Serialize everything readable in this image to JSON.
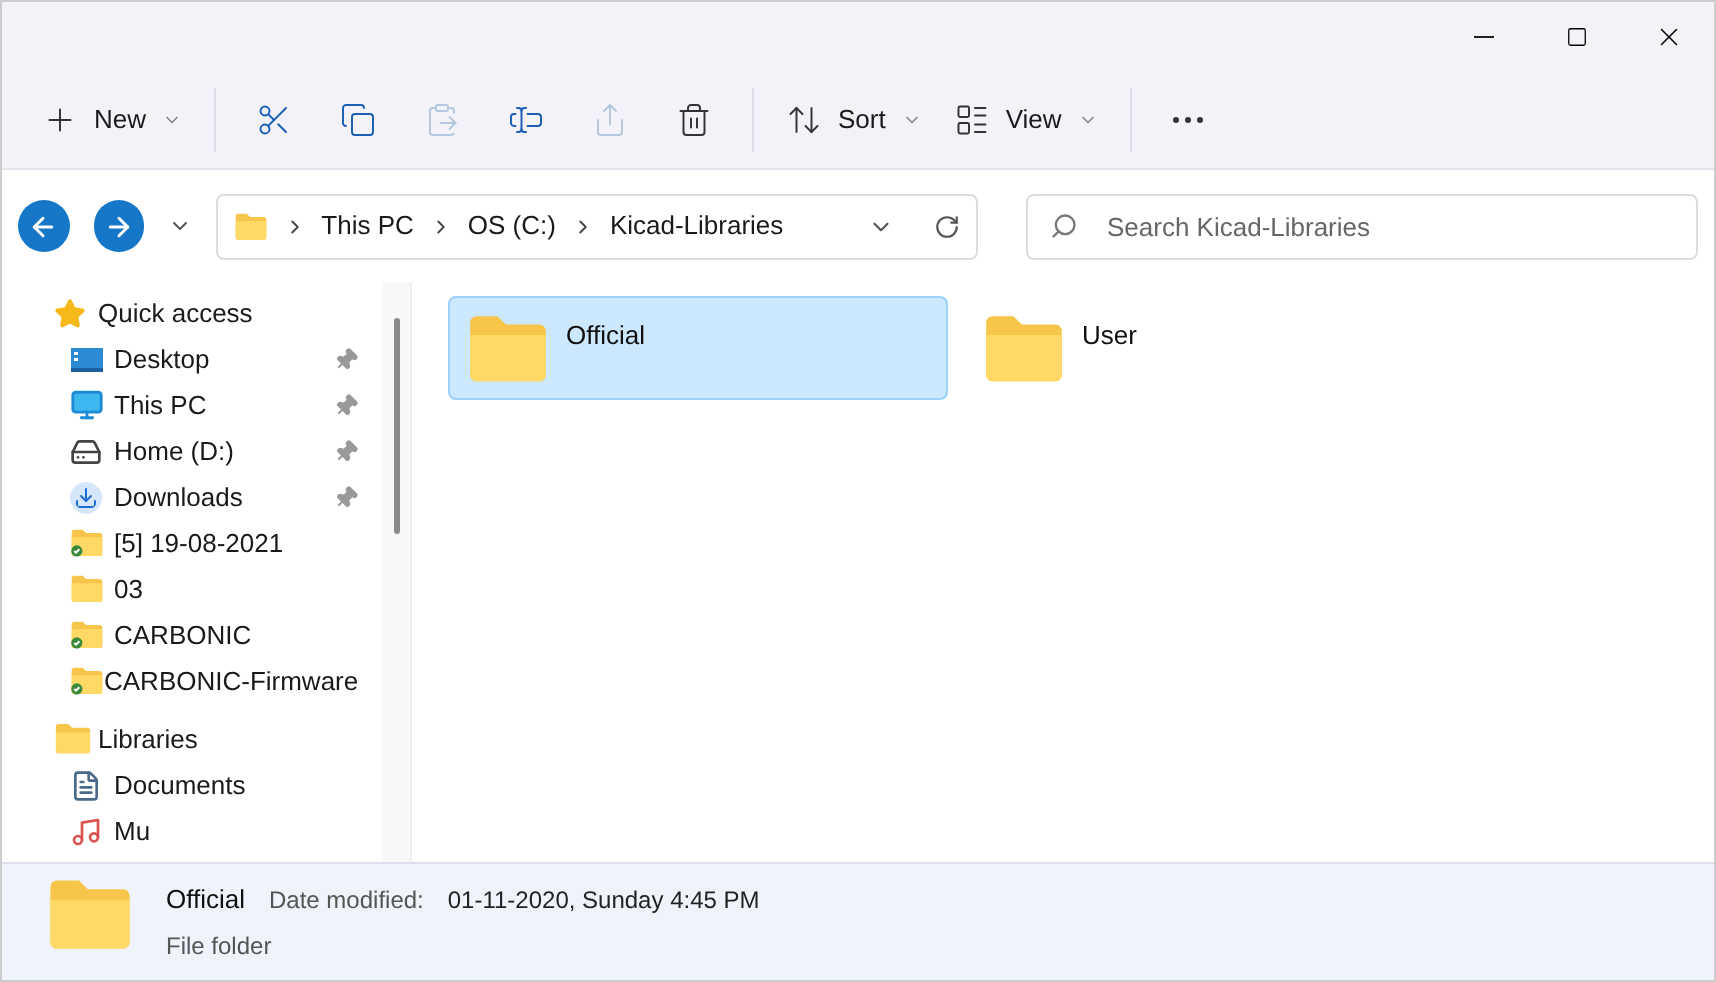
{
  "toolbar": [
    {
      "kind": "new",
      "label": "New",
      "disabled": false
    },
    {
      "kind": "cut",
      "disabled": false
    },
    {
      "kind": "copy",
      "disabled": false
    },
    {
      "kind": "paste",
      "disabled": true
    },
    {
      "kind": "rename",
      "disabled": false
    },
    {
      "kind": "share",
      "disabled": true
    },
    {
      "kind": "delete",
      "disabled": false
    },
    {
      "kind": "sort",
      "label": "Sort",
      "disabled": false
    },
    {
      "kind": "view",
      "label": "View",
      "disabled": false
    },
    {
      "kind": "more",
      "disabled": false
    }
  ],
  "address": {
    "crumbs": [
      "This PC",
      "OS (C:)",
      "Kicad-Libraries"
    ]
  },
  "search": {
    "placeholder": "Search Kicad-Libraries"
  },
  "sidebar": {
    "items": [
      {
        "kind": "star",
        "label": "Quick access",
        "pinned": false,
        "children": [
          {
            "kind": "desktop",
            "label": "Desktop",
            "pinned": true
          },
          {
            "kind": "pc",
            "label": "This PC",
            "pinned": true
          },
          {
            "kind": "drive",
            "label": "Home (D:)",
            "pinned": true
          },
          {
            "kind": "download",
            "label": "Downloads",
            "pinned": true
          },
          {
            "kind": "synced",
            "label": "[5] 19-08-2021",
            "pinned": false
          },
          {
            "kind": "folder",
            "label": "03",
            "pinned": false
          },
          {
            "kind": "synced",
            "label": "CARBONIC",
            "pinned": false
          },
          {
            "kind": "synced",
            "label": "CARBONIC-Firmware",
            "pinned": false
          }
        ]
      },
      {
        "kind": "library",
        "label": "Libraries",
        "pinned": false,
        "children": [
          {
            "kind": "documents",
            "label": "Documents",
            "pinned": false
          },
          {
            "kind": "music",
            "label": "Mu",
            "pinned": false
          }
        ]
      }
    ]
  },
  "files": [
    {
      "name": "Official",
      "selected": true
    },
    {
      "name": "User",
      "selected": false
    }
  ],
  "details": {
    "name": "Official",
    "type": "File folder",
    "date_label": "Date modified:",
    "date": "01-11-2020, Sunday 4:45 PM"
  }
}
